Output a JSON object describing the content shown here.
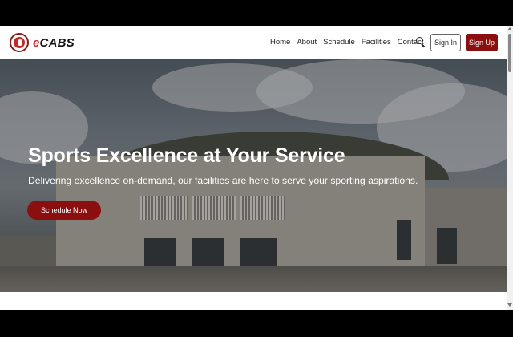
{
  "brand": {
    "name_prefix": "e",
    "name_rest": "CABS"
  },
  "nav": {
    "items": [
      "Home",
      "About",
      "Schedule",
      "Facilities",
      "Contact"
    ],
    "search_icon": "search-icon",
    "signin_label": "Sign In",
    "signup_label": "Sign Up"
  },
  "hero": {
    "title": "Sports Excellence at Your Service",
    "subtitle": "Delivering excellence on-demand, our facilities are here to serve your sporting aspirations.",
    "cta_label": "Schedule Now"
  },
  "colors": {
    "accent": "#8b0f0f",
    "logo_red": "#c62828"
  }
}
